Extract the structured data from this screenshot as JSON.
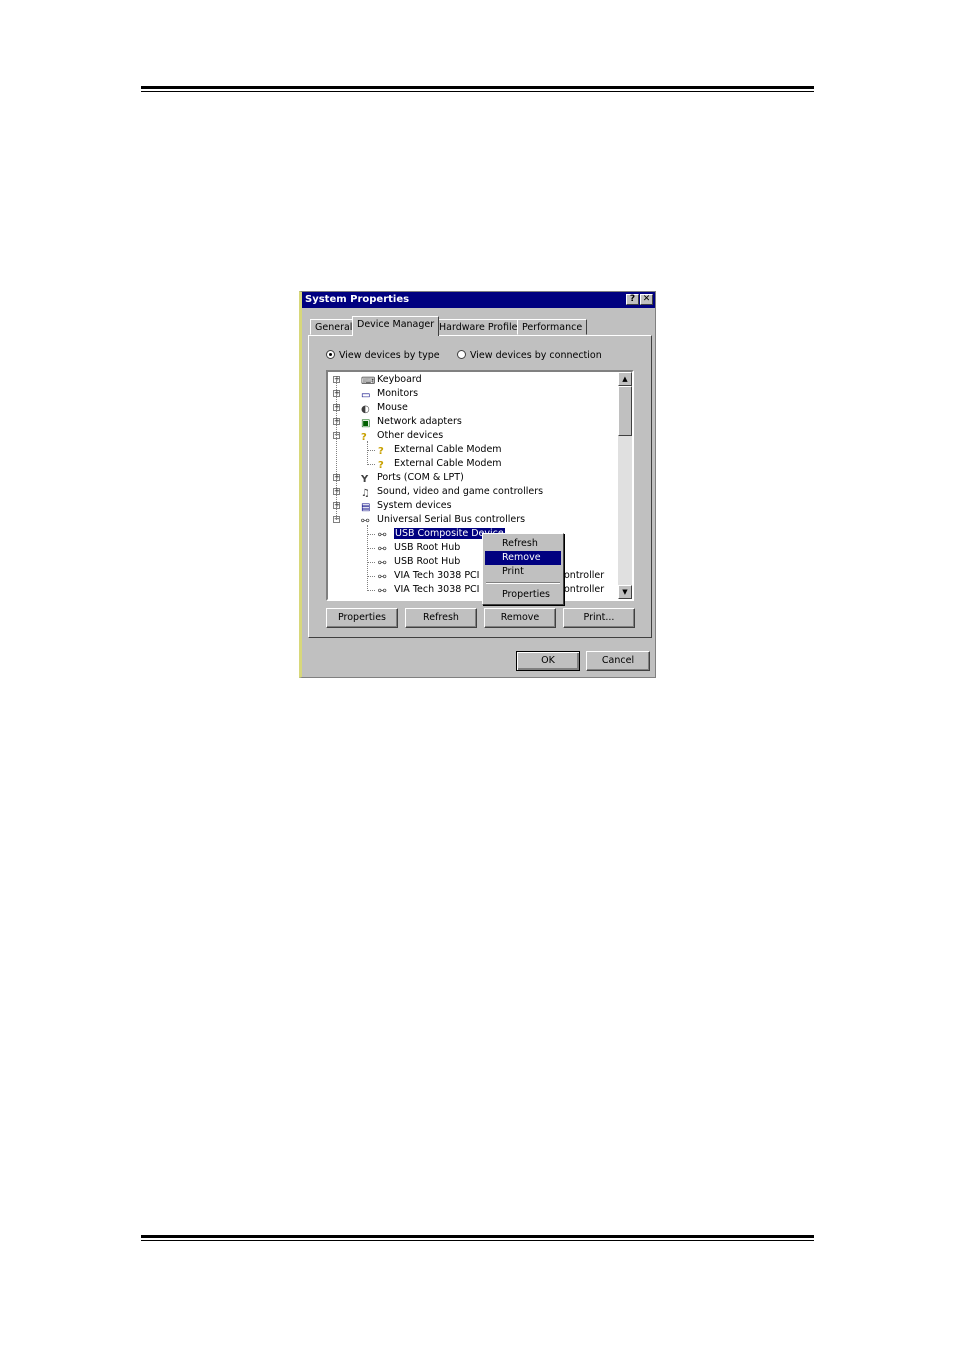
{
  "dialog": {
    "title": "System Properties",
    "help_button": "?",
    "close_button": "✕",
    "tabs": [
      "General",
      "Device Manager",
      "Hardware Profiles",
      "Performance"
    ],
    "active_tab": "Device Manager",
    "radio_by_type": "View devices by type",
    "radio_by_connection": "View devices by connection",
    "selected_view": "type",
    "tree": [
      {
        "label": "Keyboard",
        "icon": "keyboard-icon",
        "expander": "+"
      },
      {
        "label": "Monitors",
        "icon": "monitor-icon",
        "expander": "+"
      },
      {
        "label": "Mouse",
        "icon": "mouse-icon",
        "expander": "+"
      },
      {
        "label": "Network adapters",
        "icon": "network-adapter-icon",
        "expander": "+"
      },
      {
        "label": "Other devices",
        "icon": "question-icon",
        "expander": "−"
      },
      {
        "label": "External Cable Modem",
        "icon": "question-icon",
        "expander": ""
      },
      {
        "label": "External Cable Modem",
        "icon": "question-icon",
        "expander": ""
      },
      {
        "label": "Ports (COM & LPT)",
        "icon": "port-icon",
        "expander": "+"
      },
      {
        "label": "Sound, video and game controllers",
        "icon": "sound-icon",
        "expander": "+"
      },
      {
        "label": "System devices",
        "icon": "computer-icon",
        "expander": "+"
      },
      {
        "label": "Universal Serial Bus controllers",
        "icon": "usb-icon",
        "expander": "−"
      },
      {
        "label": "USB Composite Device",
        "icon": "usb-icon",
        "expander": ""
      },
      {
        "label": "USB Root Hub",
        "icon": "usb-icon",
        "expander": ""
      },
      {
        "label": "USB Root Hub",
        "icon": "usb-icon",
        "expander": ""
      },
      {
        "label": "VIA Tech 3038 PCI to U",
        "label_tail": "ontroller",
        "icon": "usb-icon",
        "expander": ""
      },
      {
        "label": "VIA Tech 3038 PCI to U",
        "label_tail": "ontroller",
        "icon": "usb-icon",
        "expander": ""
      }
    ],
    "selected_item": "USB Composite Device",
    "context_menu": [
      "Refresh",
      "Remove",
      "Print",
      "Properties"
    ],
    "context_menu_highlight": "Remove",
    "buttons": {
      "properties": "Properties",
      "refresh": "Refresh",
      "remove": "Remove",
      "print": "Print...",
      "ok": "OK",
      "cancel": "Cancel"
    }
  },
  "colors": {
    "titlebar": "#000080",
    "face": "#c0c0c0",
    "selection": "#000080"
  }
}
